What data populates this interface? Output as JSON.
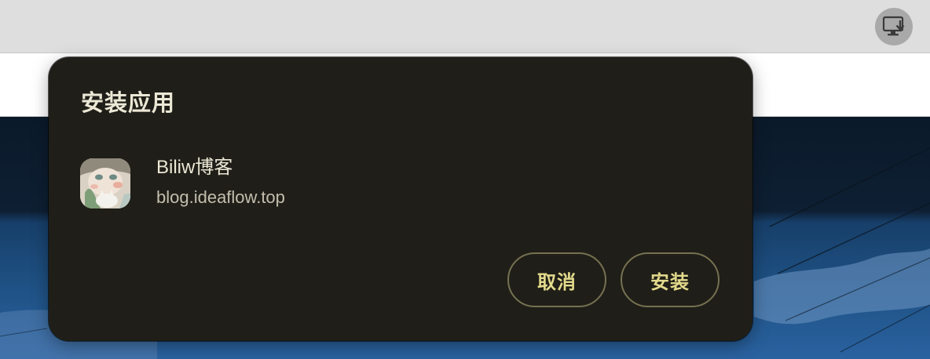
{
  "toolbar": {
    "install_icon": "install-app-icon"
  },
  "dialog": {
    "title": "安装应用",
    "app": {
      "icon": "app-icon",
      "name": "Biliw博客",
      "origin": "blog.ideaflow.top"
    },
    "buttons": {
      "cancel_label": "取消",
      "install_label": "安装"
    }
  },
  "colors": {
    "dialog_background": "#1f1e18",
    "title_text": "#ece8d6",
    "secondary_text": "#c3bfae",
    "button_text": "#e3da8c",
    "button_border": "#767151",
    "toolbar_background": "#dedede"
  }
}
